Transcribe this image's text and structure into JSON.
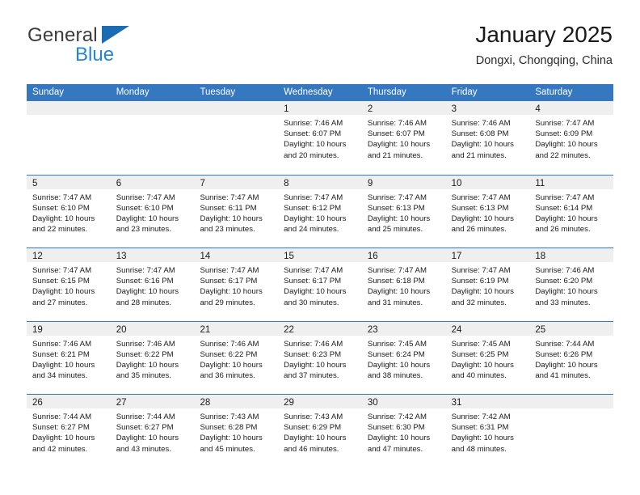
{
  "brand": {
    "name_part1": "General",
    "name_part2": "Blue",
    "triangle_icon": "triangle-icon"
  },
  "header": {
    "title": "January 2025",
    "subtitle": "Dongxi, Chongqing, China"
  },
  "colors": {
    "header_blue": "#3578bf",
    "brand_blue": "#2484d6",
    "triangle_blue": "#1c6cb5",
    "day_band_gray": "#efefef"
  },
  "weekdays": [
    "Sunday",
    "Monday",
    "Tuesday",
    "Wednesday",
    "Thursday",
    "Friday",
    "Saturday"
  ],
  "weeks": [
    [
      {
        "day": "",
        "lines": []
      },
      {
        "day": "",
        "lines": []
      },
      {
        "day": "",
        "lines": []
      },
      {
        "day": "1",
        "lines": [
          "Sunrise: 7:46 AM",
          "Sunset: 6:07 PM",
          "Daylight: 10 hours",
          "and 20 minutes."
        ]
      },
      {
        "day": "2",
        "lines": [
          "Sunrise: 7:46 AM",
          "Sunset: 6:07 PM",
          "Daylight: 10 hours",
          "and 21 minutes."
        ]
      },
      {
        "day": "3",
        "lines": [
          "Sunrise: 7:46 AM",
          "Sunset: 6:08 PM",
          "Daylight: 10 hours",
          "and 21 minutes."
        ]
      },
      {
        "day": "4",
        "lines": [
          "Sunrise: 7:47 AM",
          "Sunset: 6:09 PM",
          "Daylight: 10 hours",
          "and 22 minutes."
        ]
      }
    ],
    [
      {
        "day": "5",
        "lines": [
          "Sunrise: 7:47 AM",
          "Sunset: 6:10 PM",
          "Daylight: 10 hours",
          "and 22 minutes."
        ]
      },
      {
        "day": "6",
        "lines": [
          "Sunrise: 7:47 AM",
          "Sunset: 6:10 PM",
          "Daylight: 10 hours",
          "and 23 minutes."
        ]
      },
      {
        "day": "7",
        "lines": [
          "Sunrise: 7:47 AM",
          "Sunset: 6:11 PM",
          "Daylight: 10 hours",
          "and 23 minutes."
        ]
      },
      {
        "day": "8",
        "lines": [
          "Sunrise: 7:47 AM",
          "Sunset: 6:12 PM",
          "Daylight: 10 hours",
          "and 24 minutes."
        ]
      },
      {
        "day": "9",
        "lines": [
          "Sunrise: 7:47 AM",
          "Sunset: 6:13 PM",
          "Daylight: 10 hours",
          "and 25 minutes."
        ]
      },
      {
        "day": "10",
        "lines": [
          "Sunrise: 7:47 AM",
          "Sunset: 6:13 PM",
          "Daylight: 10 hours",
          "and 26 minutes."
        ]
      },
      {
        "day": "11",
        "lines": [
          "Sunrise: 7:47 AM",
          "Sunset: 6:14 PM",
          "Daylight: 10 hours",
          "and 26 minutes."
        ]
      }
    ],
    [
      {
        "day": "12",
        "lines": [
          "Sunrise: 7:47 AM",
          "Sunset: 6:15 PM",
          "Daylight: 10 hours",
          "and 27 minutes."
        ]
      },
      {
        "day": "13",
        "lines": [
          "Sunrise: 7:47 AM",
          "Sunset: 6:16 PM",
          "Daylight: 10 hours",
          "and 28 minutes."
        ]
      },
      {
        "day": "14",
        "lines": [
          "Sunrise: 7:47 AM",
          "Sunset: 6:17 PM",
          "Daylight: 10 hours",
          "and 29 minutes."
        ]
      },
      {
        "day": "15",
        "lines": [
          "Sunrise: 7:47 AM",
          "Sunset: 6:17 PM",
          "Daylight: 10 hours",
          "and 30 minutes."
        ]
      },
      {
        "day": "16",
        "lines": [
          "Sunrise: 7:47 AM",
          "Sunset: 6:18 PM",
          "Daylight: 10 hours",
          "and 31 minutes."
        ]
      },
      {
        "day": "17",
        "lines": [
          "Sunrise: 7:47 AM",
          "Sunset: 6:19 PM",
          "Daylight: 10 hours",
          "and 32 minutes."
        ]
      },
      {
        "day": "18",
        "lines": [
          "Sunrise: 7:46 AM",
          "Sunset: 6:20 PM",
          "Daylight: 10 hours",
          "and 33 minutes."
        ]
      }
    ],
    [
      {
        "day": "19",
        "lines": [
          "Sunrise: 7:46 AM",
          "Sunset: 6:21 PM",
          "Daylight: 10 hours",
          "and 34 minutes."
        ]
      },
      {
        "day": "20",
        "lines": [
          "Sunrise: 7:46 AM",
          "Sunset: 6:22 PM",
          "Daylight: 10 hours",
          "and 35 minutes."
        ]
      },
      {
        "day": "21",
        "lines": [
          "Sunrise: 7:46 AM",
          "Sunset: 6:22 PM",
          "Daylight: 10 hours",
          "and 36 minutes."
        ]
      },
      {
        "day": "22",
        "lines": [
          "Sunrise: 7:46 AM",
          "Sunset: 6:23 PM",
          "Daylight: 10 hours",
          "and 37 minutes."
        ]
      },
      {
        "day": "23",
        "lines": [
          "Sunrise: 7:45 AM",
          "Sunset: 6:24 PM",
          "Daylight: 10 hours",
          "and 38 minutes."
        ]
      },
      {
        "day": "24",
        "lines": [
          "Sunrise: 7:45 AM",
          "Sunset: 6:25 PM",
          "Daylight: 10 hours",
          "and 40 minutes."
        ]
      },
      {
        "day": "25",
        "lines": [
          "Sunrise: 7:44 AM",
          "Sunset: 6:26 PM",
          "Daylight: 10 hours",
          "and 41 minutes."
        ]
      }
    ],
    [
      {
        "day": "26",
        "lines": [
          "Sunrise: 7:44 AM",
          "Sunset: 6:27 PM",
          "Daylight: 10 hours",
          "and 42 minutes."
        ]
      },
      {
        "day": "27",
        "lines": [
          "Sunrise: 7:44 AM",
          "Sunset: 6:27 PM",
          "Daylight: 10 hours",
          "and 43 minutes."
        ]
      },
      {
        "day": "28",
        "lines": [
          "Sunrise: 7:43 AM",
          "Sunset: 6:28 PM",
          "Daylight: 10 hours",
          "and 45 minutes."
        ]
      },
      {
        "day": "29",
        "lines": [
          "Sunrise: 7:43 AM",
          "Sunset: 6:29 PM",
          "Daylight: 10 hours",
          "and 46 minutes."
        ]
      },
      {
        "day": "30",
        "lines": [
          "Sunrise: 7:42 AM",
          "Sunset: 6:30 PM",
          "Daylight: 10 hours",
          "and 47 minutes."
        ]
      },
      {
        "day": "31",
        "lines": [
          "Sunrise: 7:42 AM",
          "Sunset: 6:31 PM",
          "Daylight: 10 hours",
          "and 48 minutes."
        ]
      },
      {
        "day": "",
        "lines": []
      }
    ]
  ]
}
